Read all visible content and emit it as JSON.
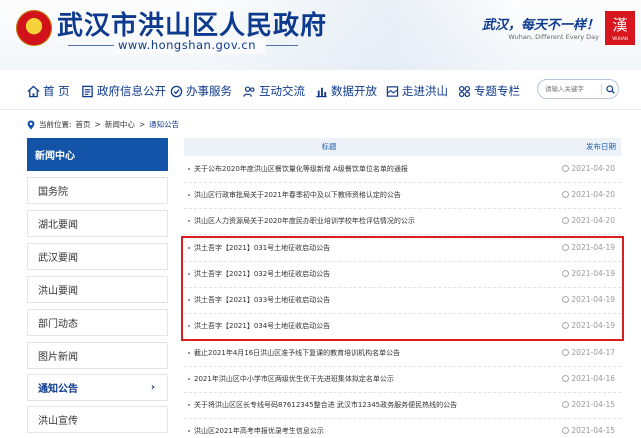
{
  "header": {
    "site_name": "武汉市洪山区人民政府",
    "site_url": "www.hongshan.gov.cn",
    "slogan": "武汉，每天不一样！",
    "slogan_en": "Wuhan, Different Every Day",
    "logo_text": "漢",
    "logo_sub": "WUHAN"
  },
  "nav": {
    "items": [
      {
        "label": "首 页",
        "icon": "home-icon"
      },
      {
        "label": "政府信息公开",
        "icon": "document-icon"
      },
      {
        "label": "办事服务",
        "icon": "service-icon"
      },
      {
        "label": "互动交流",
        "icon": "people-icon"
      },
      {
        "label": "数据开放",
        "icon": "bar-chart-icon"
      },
      {
        "label": "走进洪山",
        "icon": "city-icon"
      },
      {
        "label": "专题专栏",
        "icon": "grid-icon"
      }
    ],
    "search_placeholder": "请输入关键字"
  },
  "breadcrumb": {
    "prefix": "当前位置:",
    "home": "首页",
    "section": "新闻中心",
    "current": "通知公告",
    "sep": ">"
  },
  "sidebar": {
    "title": "新闻中心",
    "items": [
      {
        "label": "国务院"
      },
      {
        "label": "湖北要闻"
      },
      {
        "label": "武汉要闻"
      },
      {
        "label": "洪山要闻"
      },
      {
        "label": "部门动态"
      },
      {
        "label": "图片新闻"
      },
      {
        "label": "通知公告",
        "active": true
      },
      {
        "label": "洪山宣传"
      }
    ]
  },
  "list": {
    "col_title": "标题",
    "col_date": "发布日期",
    "rows": [
      {
        "title": "关于公布2020年度洪山区餐饮量化等级新增 A级餐饮单位名单的通报",
        "date": "2021-04-20"
      },
      {
        "title": "洪山区行政审批局关于2021年春季初中及以下教师资格认定的公告",
        "date": "2021-04-20"
      },
      {
        "title": "洪山区人力资源局关于2020年度民办职业培训学校年检评估情况的公示",
        "date": "2021-04-20"
      },
      {
        "title": "洪土吾字【2021】031号土地征收启动公告",
        "date": "2021-04-19"
      },
      {
        "title": "洪土吾字【2021】032号土地征收启动公告",
        "date": "2021-04-19"
      },
      {
        "title": "洪土吾字【2021】033号土地征收启动公告",
        "date": "2021-04-19"
      },
      {
        "title": "洪土吾字【2021】034号土地征收启动公告",
        "date": "2021-04-19"
      },
      {
        "title": "截止2021年4月16日洪山区准予线下复课的教育培训机构名单公告",
        "date": "2021-04-17"
      },
      {
        "title": "2021年洪山区中小学市区两级优生优干先进班集体拟定名单公示",
        "date": "2021-04-16"
      },
      {
        "title": "关于将洪山区区长专线号码87612345整合进 武汉市12345政务服务便民热线的公告",
        "date": "2021-04-15"
      },
      {
        "title": "洪山区2021年高考申报优录考生信息公示",
        "date": "2021-04-15"
      }
    ]
  },
  "colors": {
    "brand_blue": "#0e3a8e",
    "sidebar_title_bg": "#1454a8",
    "highlight_red": "#d81e1e"
  }
}
